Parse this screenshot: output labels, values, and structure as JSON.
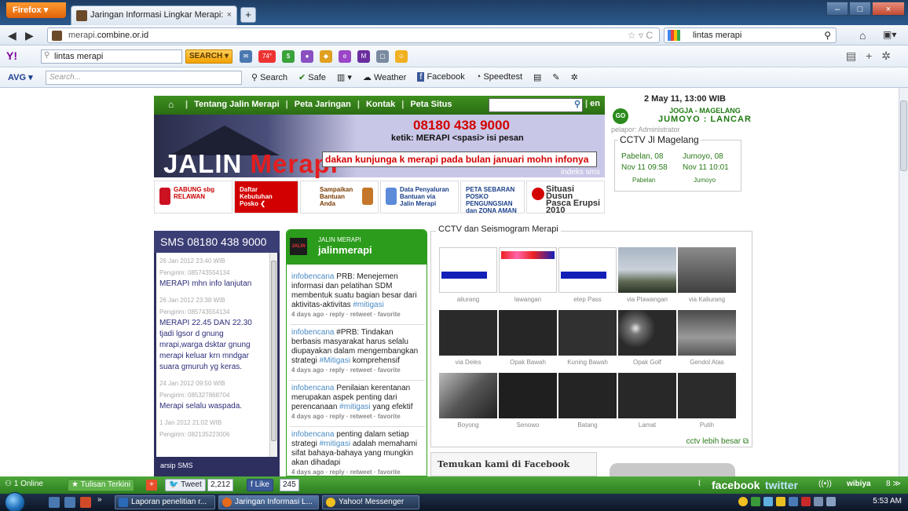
{
  "browser": {
    "firefox_label": "Firefox",
    "tab_title": "Jaringan Informasi Lingkar Merapi:",
    "url_domain": "merapi.combine.or.id",
    "url_prefix": "merapi.",
    "url_main": "combine.or.id",
    "search_query": "lintas merapi"
  },
  "yahoo": {
    "logo": "Y!",
    "query": "lintas merapi",
    "search_btn": "SEARCH",
    "temp": "74°"
  },
  "avg": {
    "logo": "AVG",
    "placeholder": "Search...",
    "search": "Search",
    "safe": "Safe",
    "weather": "Weather",
    "facebook": "Facebook",
    "speedtest": "Speedtest"
  },
  "site": {
    "nav": [
      "Tentang Jalin Merapi",
      "Peta Jaringan",
      "Kontak",
      "Peta Situs"
    ],
    "lang": "en",
    "banner": {
      "logo_white": "JALIN ",
      "logo_red": "Merapi",
      "phone": "08180 438 9000",
      "ketik": "ketik: MERAPI <spasi> isi pesan",
      "ticker": "dakan kunjunga k merapi pada bulan januari mohn infonya",
      "indeks": "indeks sms"
    },
    "buttons": [
      {
        "l1": "GABUNG sbg",
        "l2": "RELAWAN"
      },
      {
        "l1": "Daftar",
        "l2": "Kebutuhan",
        "l3": "Posko"
      },
      {
        "l1": "Sampaikan",
        "l2": "Bantuan",
        "l3": "Anda"
      },
      {
        "l1": "Data Penyaluran",
        "l2": "Bantuan via",
        "l3": "Jalin Merapi"
      },
      {
        "l1": "PETA SEBARAN",
        "l2": "POSKO PENGUNGSIAN",
        "l3": "dan ZONA AMAN"
      },
      {
        "l1": "Situasi Dusun",
        "l2": "Pasca Erupsi 2010"
      }
    ]
  },
  "right_info": {
    "date": "2 May 11, 13:00 WIB",
    "go": "GO",
    "route1": "JOGJA - MAGELANG",
    "route2": "JUMOYO : LANCAR",
    "pelapor": "pelapor: Administrator",
    "cctv_title": "CCTV Jl Magelang",
    "cam1": {
      "line1": "Pabelan, 08",
      "line2": "Nov 11 09:58",
      "cap": "Pabelan"
    },
    "cam2": {
      "line1": "Jumoyo, 08",
      "line2": "Nov 11 10:01",
      "cap": "Jumoyo"
    }
  },
  "sms": {
    "title": "SMS 08180 438 9000",
    "items": [
      {
        "time": "26 Jan 2012 23:40 WIB",
        "sender": "Pengirim: 085743554134",
        "msg": "MERAPI mhn info lanjutan"
      },
      {
        "time": "26 Jan 2012 23:38 WIB",
        "sender": "Pengirim: 085743554134",
        "msg": "MERAPI 22.45 DAN 22.30 tjadi lgsor d gnung mrapi,warga dsktar gnung merapi keluar krn mndgar suara gmuruh yg keras."
      },
      {
        "time": "24 Jan 2012 09:50 WIB",
        "sender": "Pengirim: 085327868704",
        "msg": "Merapi selalu waspada."
      },
      {
        "time": "1 Jan 2012 21:02 WIB",
        "sender": "Pengirim: 082135223006",
        "msg": ""
      }
    ],
    "footer": "arsip SMS"
  },
  "twitter": {
    "avatar": "JALIN",
    "small": "JALIN MERAPI",
    "name": "jalinmerapi",
    "tweets": [
      {
        "user": "infobencana",
        "text": " PRB: Menejemen informasi dan pelatihan SDM membentuk suatu bagian besar dari aktivitas-aktivitas ",
        "tag": "#mitigasi",
        "meta": "4 days ago · reply · retweet · favorite"
      },
      {
        "user": "infobencana",
        "text": " #PRB: Tindakan berbasis masyarakat harus selalu diupayakan dalam mengembangkan strategi ",
        "tag": "#Mitigasi",
        "after": " komprehensif",
        "meta": "4 days ago · reply · retweet · favorite"
      },
      {
        "user": "infobencana",
        "text": " Penilaian kerentanan merupakan aspek penting dari perencanaan ",
        "tag": "#mitigasi",
        "after": " yang efektif",
        "meta": "4 days ago · reply · retweet · favorite"
      },
      {
        "user": "infobencana",
        "text": " penting dalam setiap strategi ",
        "tag": "#mitigasi",
        "after": " adalah memahami sifat bahaya-bahaya yang mungkin akan dihadapi",
        "meta": "4 days ago · reply · retweet · favorite"
      }
    ]
  },
  "cctv": {
    "title": "CCTV dan Seismogram Merapi",
    "cells": [
      "aliurang",
      "lawangan",
      "etep Pass",
      "via Plawangan",
      "via Kaliurang",
      "via Deles",
      "Opak Bawah",
      "Kuning Bawah",
      "Opak Golf",
      "Gendol Atas",
      "Boyong",
      "Senowo",
      "Batang",
      "Lamat",
      "Putih"
    ],
    "more": "cctv lebih besar"
  },
  "facebook_box": "Temukan kami di Facebook",
  "wibiya": {
    "online": "1 Online",
    "tulisan": "Tulisan Terkini",
    "tweet": "Tweet",
    "tweet_count": "2,212",
    "like": "Like",
    "like_count": "245",
    "facebook": "facebook",
    "twitter": "twitter",
    "powered": "wibiya"
  },
  "taskbar": {
    "tasks": [
      "Laporan penelitian r...",
      "Jaringan Informasi L...",
      "Yahoo! Messenger"
    ],
    "time": "5:53 AM"
  }
}
